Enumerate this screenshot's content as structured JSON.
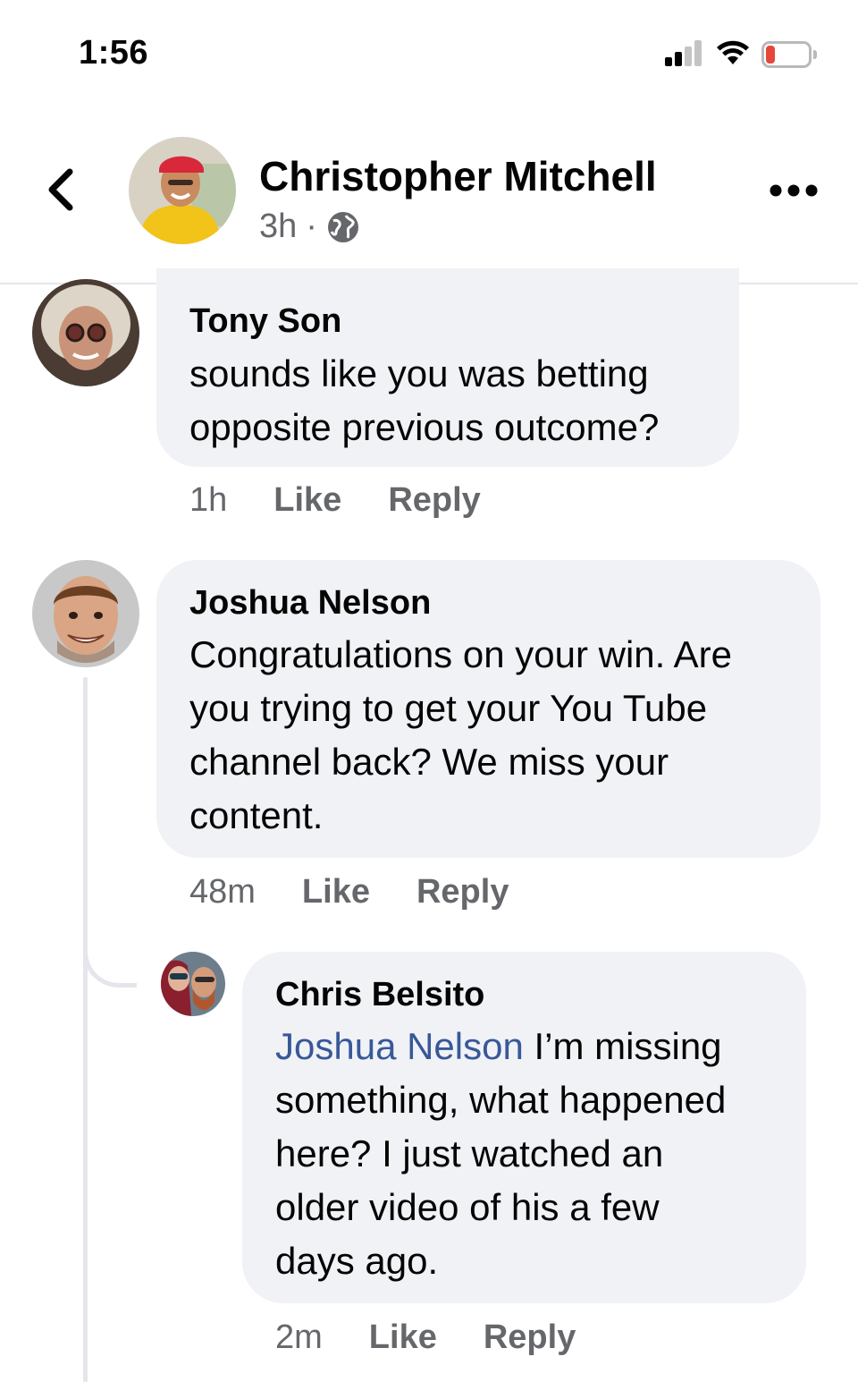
{
  "status_bar": {
    "time": "1:56",
    "battery": "11"
  },
  "header": {
    "author": "Christopher Mitchell",
    "time": "3h",
    "separator": "·",
    "privacy_icon": "globe-icon",
    "back_icon": "chevron-left-icon",
    "more_icon": "more-horizontal-icon"
  },
  "comments": [
    {
      "author": "Tony Son",
      "lines": [
        "sounds like you was betting",
        "opposite previous outcome?"
      ],
      "time": "1h",
      "like": "Like",
      "reply": "Reply"
    },
    {
      "author": "Joshua Nelson",
      "lines": [
        "Congratulations on your win. Are",
        "you trying to get your You Tube",
        "channel back? We miss your",
        "content."
      ],
      "time": "48m",
      "like": "Like",
      "reply": "Reply"
    },
    {
      "author": "Chris Belsito",
      "mention": "Joshua Nelson",
      "lines": [
        " I’m missing",
        "something, what happened",
        "here? I just watched an",
        "older video of his a few",
        "days ago."
      ],
      "time": "2m",
      "like": "Like",
      "reply": "Reply"
    }
  ],
  "colors": {
    "bubble": "#f0f2f5",
    "mention": "#385898",
    "secondary_text": "#65676b",
    "battery_low": "#e5473b"
  }
}
